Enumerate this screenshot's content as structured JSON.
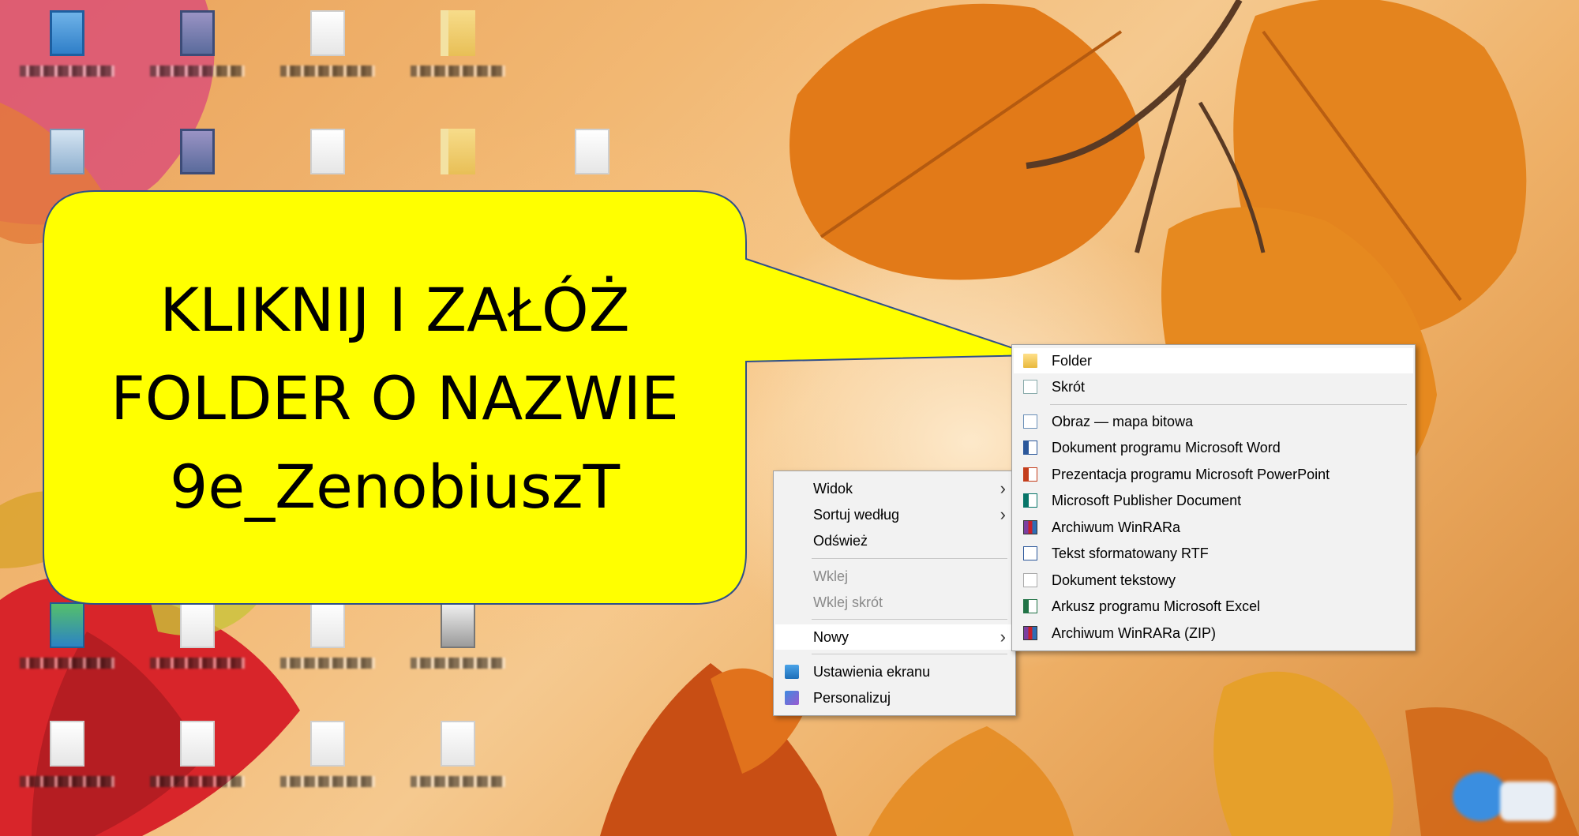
{
  "annotation": {
    "lines": [
      "KLIKNIJ I ZAŁÓŻ",
      "FOLDER O NAZWIE",
      "9e_ZenobiuszT"
    ],
    "fill_color": "#ffff00",
    "text_color": "#000000"
  },
  "context_menu": {
    "items": [
      {
        "label": "Widok",
        "submenu": true
      },
      {
        "label": "Sortuj według",
        "submenu": true
      },
      {
        "label": "Odśwież"
      },
      {
        "label": "Wklej",
        "disabled": true
      },
      {
        "label": "Wklej skrót",
        "disabled": true
      },
      {
        "label": "Nowy",
        "submenu": true,
        "highlighted": true
      },
      {
        "label": "Ustawienia ekranu",
        "icon": "display-settings-icon"
      },
      {
        "label": "Personalizuj",
        "icon": "personalize-icon"
      }
    ]
  },
  "new_submenu": {
    "items": [
      {
        "label": "Folder",
        "icon": "folder-icon",
        "highlighted": true
      },
      {
        "label": "Skrót",
        "icon": "shortcut-icon"
      },
      {
        "label": "Obraz — mapa bitowa",
        "icon": "bitmap-icon"
      },
      {
        "label": "Dokument programu Microsoft Word",
        "icon": "word-icon"
      },
      {
        "label": "Prezentacja programu Microsoft PowerPoint",
        "icon": "powerpoint-icon"
      },
      {
        "label": "Microsoft Publisher Document",
        "icon": "publisher-icon"
      },
      {
        "label": "Archiwum WinRARa",
        "icon": "winrar-icon"
      },
      {
        "label": "Tekst sformatowany RTF",
        "icon": "rtf-icon"
      },
      {
        "label": "Dokument tekstowy",
        "icon": "text-document-icon"
      },
      {
        "label": "Arkusz programu Microsoft Excel",
        "icon": "excel-icon"
      },
      {
        "label": "Archiwum WinRARa (ZIP)",
        "icon": "winrar-zip-icon"
      }
    ]
  },
  "colors": {
    "menu_background": "#f2f2f2",
    "menu_hover": "#ffffff",
    "disabled_text": "#8a8a8a",
    "bubble_fill": "#ffff00"
  }
}
